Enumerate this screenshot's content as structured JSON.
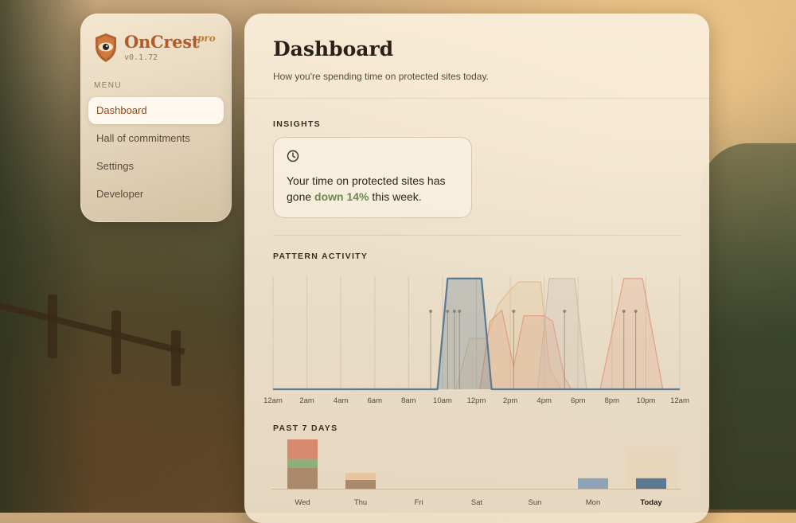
{
  "brand": {
    "name": "OnCrest",
    "tier": "pro",
    "version": "v0.1.72"
  },
  "sidebar": {
    "menu_label": "MENU",
    "items": [
      {
        "label": "Dashboard",
        "active": true
      },
      {
        "label": "Hall of commitments",
        "active": false
      },
      {
        "label": "Settings",
        "active": false
      },
      {
        "label": "Developer",
        "active": false
      }
    ]
  },
  "main": {
    "title": "Dashboard",
    "subtitle": "How you're spending time on protected sites today."
  },
  "insights": {
    "label": "INSIGHTS",
    "icon": "clock-icon",
    "text_before": "Your time on protected sites has gone ",
    "highlight": "down 14%",
    "text_after": " this week.",
    "highlight_color": "#6d8a4e"
  },
  "colors": {
    "accent": "#b15a2a",
    "slate": "#5b7a92",
    "tan": "#e0b98a",
    "coral": "#e2947a",
    "sage": "#8fae7a",
    "brown": "#a98a6a"
  },
  "chart_data": [
    {
      "type": "area",
      "title": "PATTERN ACTIVITY",
      "x_ticks": [
        "12am",
        "2am",
        "4am",
        "6am",
        "8am",
        "10am",
        "12pm",
        "2pm",
        "4pm",
        "6pm",
        "8pm",
        "10pm",
        "12am"
      ],
      "xlim": [
        0,
        24
      ],
      "ylim": [
        0,
        1
      ],
      "grid": true,
      "series": [
        {
          "color": "#e0b98a",
          "points": [
            [
              10.8,
              0
            ],
            [
              11.6,
              0.45
            ],
            [
              12.6,
              0.45
            ],
            [
              13.3,
              0.75
            ],
            [
              14.0,
              0.88
            ],
            [
              14.5,
              0.95
            ],
            [
              15.8,
              0.95
            ],
            [
              16.3,
              0.2
            ],
            [
              17.0,
              0
            ]
          ]
        },
        {
          "color": "#e2947a",
          "points": [
            [
              12.2,
              0
            ],
            [
              12.8,
              0.6
            ],
            [
              13.5,
              0.7
            ],
            [
              14.2,
              0.2
            ],
            [
              14.8,
              0.65
            ],
            [
              16.0,
              0.65
            ],
            [
              16.5,
              0.6
            ],
            [
              17.2,
              0.1
            ],
            [
              17.6,
              0
            ]
          ]
        },
        {
          "color": "#c4b8aa",
          "points": [
            [
              15.6,
              0
            ],
            [
              16.3,
              0.98
            ],
            [
              17.8,
              0.98
            ],
            [
              18.5,
              0
            ]
          ]
        },
        {
          "color": "#e2947a",
          "points": [
            [
              19.3,
              0
            ],
            [
              20.7,
              0.98
            ],
            [
              21.8,
              0.98
            ],
            [
              23.0,
              0
            ]
          ]
        },
        {
          "color": "#5b7a92",
          "points": [
            [
              0,
              0
            ],
            [
              9.7,
              0
            ],
            [
              10.3,
              0.98
            ],
            [
              12.3,
              0.98
            ],
            [
              12.9,
              0
            ],
            [
              24,
              0
            ]
          ]
        }
      ],
      "event_markers": [
        9.3,
        10.3,
        10.7,
        11.0,
        14.2,
        17.2,
        20.7,
        21.4
      ]
    },
    {
      "type": "bar",
      "title": "PAST 7 DAYS",
      "categories": [
        "Wed",
        "Thu",
        "Fri",
        "Sat",
        "Sun",
        "Mon",
        "Today"
      ],
      "current_index": 6,
      "segment_colors": [
        "#a98a6a",
        "#8fae7a",
        "#d98a6e",
        "#e8c5a0"
      ],
      "stacks": [
        [
          0.12,
          0.05,
          0.17,
          0.12
        ],
        [
          0.05,
          0,
          0,
          0.04
        ],
        [
          0,
          0,
          0,
          0
        ],
        [
          0,
          0,
          0,
          0
        ],
        [
          0,
          0,
          0,
          0
        ],
        [
          0,
          0,
          0,
          0
        ],
        [
          0,
          0,
          0,
          0
        ]
      ],
      "slate_values": [
        0,
        0,
        0,
        0,
        0,
        0.06,
        0.06
      ],
      "ylim": [
        0,
        0.5
      ]
    }
  ]
}
